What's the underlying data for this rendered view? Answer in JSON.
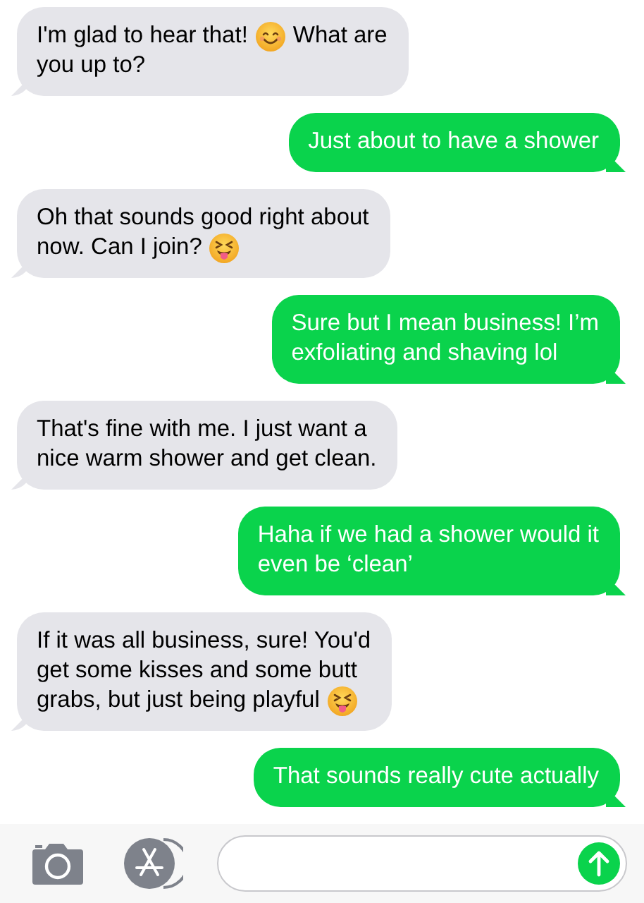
{
  "messages": [
    {
      "kind": "received",
      "lines": [
        [
          {
            "kind": "text",
            "text": "I'm glad to hear that!"
          },
          {
            "kind": "smile-emoji"
          },
          {
            "kind": "text",
            "text": "What are"
          }
        ],
        [
          {
            "kind": "text",
            "text": "you up to?"
          }
        ]
      ]
    },
    {
      "kind": "sent",
      "lines": [
        [
          {
            "kind": "text",
            "text": "Just about to have a shower"
          }
        ]
      ]
    },
    {
      "kind": "received",
      "lines": [
        [
          {
            "kind": "text",
            "text": "Oh that sounds good right about"
          }
        ],
        [
          {
            "kind": "text",
            "text": "now. Can I join?"
          },
          {
            "kind": "tongue-emoji"
          }
        ]
      ]
    },
    {
      "kind": "sent",
      "lines": [
        [
          {
            "kind": "text",
            "text": "Sure but I mean business! I’m"
          }
        ],
        [
          {
            "kind": "text",
            "text": "exfoliating and shaving lol"
          }
        ]
      ]
    },
    {
      "kind": "received",
      "lines": [
        [
          {
            "kind": "text",
            "text": "That's fine with me. I just want a"
          }
        ],
        [
          {
            "kind": "text",
            "text": "nice warm shower and get clean."
          }
        ]
      ]
    },
    {
      "kind": "sent",
      "lines": [
        [
          {
            "kind": "text",
            "text": "Haha if we had a shower would it"
          }
        ],
        [
          {
            "kind": "text",
            "text": "even be ‘clean’"
          }
        ]
      ]
    },
    {
      "kind": "received",
      "lines": [
        [
          {
            "kind": "text",
            "text": "If it was all business, sure! You'd"
          }
        ],
        [
          {
            "kind": "text",
            "text": "get some kisses and some butt"
          }
        ],
        [
          {
            "kind": "text",
            "text": "grabs, but just being playful"
          },
          {
            "kind": "tongue-emoji"
          }
        ]
      ]
    },
    {
      "kind": "sent",
      "lines": [
        [
          {
            "kind": "text",
            "text": "That sounds really cute actually"
          }
        ]
      ]
    }
  ],
  "composer": {
    "buttons": [
      {
        "kind": "camera"
      },
      {
        "kind": "apps"
      }
    ],
    "field": {
      "kind": "send"
    }
  }
}
